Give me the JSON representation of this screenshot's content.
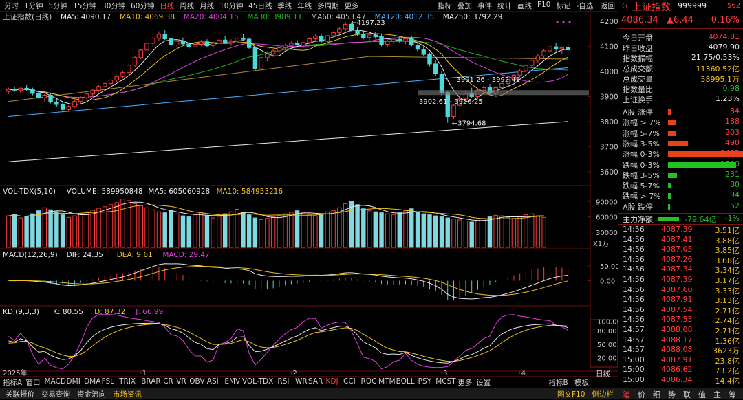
{
  "topbar": {
    "left": [
      "分时",
      "1分钟",
      "5分钟",
      "15分钟",
      "30分钟",
      "60分钟",
      "日线",
      "周线",
      "月线",
      "10分钟",
      "45日线",
      "季线",
      "年线",
      "多周期",
      "更多"
    ],
    "active": "日线",
    "right": [
      "指标",
      "叠加",
      "事件",
      "统计",
      "画线",
      "F10",
      "标记",
      "-自选",
      "返回"
    ]
  },
  "main": {
    "title": "上证指数(日线)",
    "legend": [
      {
        "label": "MA5: 4090.17",
        "color": "#e8e8e8"
      },
      {
        "label": "MA10: 4069.38",
        "color": "#f0c020"
      },
      {
        "label": "MA20: 4004.15",
        "color": "#e040e0"
      },
      {
        "label": "MA30: 3989.11",
        "color": "#20b020"
      },
      {
        "label": "MA60: 4053.47",
        "color": "#c0c0c0"
      },
      {
        "label": "MA120: 4012.35",
        "color": "#4ab0ff"
      },
      {
        "label": "MA250: 3792.29",
        "color": "#e8e8e8"
      }
    ],
    "annotations": [
      "4197.23",
      "3794.68",
      "3991.26 - 3992.41",
      "3902.61 - 3926.25"
    ]
  },
  "vol": {
    "legend": [
      {
        "label": "VOL-TDX(5,10)",
        "color": "#e8e8e8"
      },
      {
        "label": "VOLUME: 589950848",
        "color": "#e8e8e8"
      },
      {
        "label": "MA5: 605060928",
        "color": "#e8e8e8"
      },
      {
        "label": "MA10: 584953216",
        "color": "#f0c020"
      }
    ],
    "unit": "X1万"
  },
  "macd": {
    "legend": [
      {
        "label": "MACD(12,26,9)",
        "color": "#e8e8e8"
      },
      {
        "label": "DIF: 24.35",
        "color": "#e8e8e8"
      },
      {
        "label": "DEA: 9.61",
        "color": "#f0c020"
      },
      {
        "label": "MACD: 29.47",
        "color": "#e040e0"
      }
    ]
  },
  "kdj": {
    "legend": [
      {
        "label": "KDJ(9,3,3)",
        "color": "#e8e8e8"
      },
      {
        "label": "K: 80.55",
        "color": "#e8e8e8"
      },
      {
        "label": "D: 87.32",
        "color": "#f0c020"
      },
      {
        "label": "J: 66.99",
        "color": "#e040e0"
      }
    ]
  },
  "xaxis": {
    "year_label": "2025年",
    "months": [
      "1",
      "2",
      "3",
      "4"
    ],
    "period": "日线"
  },
  "bottombar": {
    "items": [
      "指标A",
      "窗口",
      "MACD",
      "DMI",
      "DMA",
      "FSL",
      "TRIX",
      "BRAR",
      "CR",
      "VR",
      "OBV",
      "ASI",
      "EMV",
      "VOL-TDX",
      "RSI",
      "WR",
      "SAR",
      "KDJ",
      "CCI",
      "ROC",
      "MTM",
      "BOLL",
      "PSY",
      "MCST",
      "更多",
      "设置"
    ],
    "active": "KDJ",
    "right": [
      "指标B",
      "模板"
    ]
  },
  "statusbar": {
    "items": [
      "关联报价",
      "交易查询",
      "资金流向",
      "市场资讯"
    ],
    "active": "市场资讯",
    "right": [
      "图文F10",
      "侧边栏"
    ]
  },
  "panel": {
    "name": "上证指数",
    "code": "999999",
    "flag": "G",
    "badge": "$62",
    "price": "4086.34",
    "change": "▲6.44",
    "pct": "0.16%",
    "stats": [
      {
        "label": "今日开盘",
        "value": "4074.81",
        "cls": "red"
      },
      {
        "label": "昨日收盘",
        "value": "4079.90",
        "cls": "wht"
      },
      {
        "label": "指数振幅",
        "value": "21.75/0.53%",
        "cls": "wht"
      },
      {
        "label": "总成交额",
        "value": "11360.52亿",
        "cls": "yel"
      },
      {
        "label": "总成交量",
        "value": "58995.1万",
        "cls": "yel"
      },
      {
        "label": "指数量比",
        "value": "0.98",
        "cls": "grn"
      },
      {
        "label": "上证换手",
        "value": "1.23%",
        "cls": "wht"
      }
    ],
    "breadth": [
      {
        "label": "A股 涨停",
        "value": "84",
        "dir": "up"
      },
      {
        "label": "涨幅 > 7%",
        "value": "188",
        "dir": "up"
      },
      {
        "label": "涨幅 5-7%",
        "value": "203",
        "dir": "up"
      },
      {
        "label": "涨幅 3-5%",
        "value": "490",
        "dir": "up"
      },
      {
        "label": "涨幅 0-3%",
        "value": "2403",
        "dir": "up"
      },
      {
        "label": "跌幅 0-3%",
        "value": "1700",
        "dir": "down"
      },
      {
        "label": "跌幅 3-5%",
        "value": "231",
        "dir": "down"
      },
      {
        "label": "跌幅 5-7%",
        "value": "80",
        "dir": "down"
      },
      {
        "label": "跌幅 > 7%",
        "value": "94",
        "dir": "down"
      },
      {
        "label": "A股 跌停",
        "value": "52",
        "dir": "down"
      }
    ],
    "capital": {
      "label": "主力净额",
      "value": "-79.64亿",
      "pct": "-1%",
      "ratio": 0.3
    },
    "ticks": [
      [
        "14:56",
        "4087.39",
        "3.51亿"
      ],
      [
        "14:56",
        "4087.41",
        "3.88亿"
      ],
      [
        "14:56",
        "4087.05",
        "3.85亿"
      ],
      [
        "14:56",
        "4087.26",
        "3.68亿"
      ],
      [
        "14:56",
        "4087.34",
        "3.34亿"
      ],
      [
        "14:56",
        "4087.39",
        "3.17亿"
      ],
      [
        "14:56",
        "4087.60",
        "3.33亿"
      ],
      [
        "14:56",
        "4087.91",
        "3.13亿"
      ],
      [
        "14:56",
        "4087.54",
        "2.71亿"
      ],
      [
        "14:56",
        "4087.53",
        "2.74亿"
      ],
      [
        "14:57",
        "4088.08",
        "2.71亿"
      ],
      [
        "14:57",
        "4088.17",
        "1.36亿"
      ],
      [
        "14:57",
        "4088.08",
        "3623万"
      ],
      [
        "15:00",
        "4087.91",
        "23.8亿"
      ],
      [
        "15:00",
        "4086.62",
        "73.2亿"
      ],
      [
        "15:00",
        "4086.34",
        "14.4亿"
      ]
    ],
    "tabs": [
      "笔",
      "价",
      "细",
      "势",
      "联",
      "值",
      "主",
      "筹"
    ]
  },
  "chart_data": [
    {
      "type": "candlestick",
      "title": "上证指数(日线)",
      "ylim": [
        3550,
        4230
      ],
      "yticks": [
        3600,
        3700,
        3800,
        3900,
        4000,
        4100,
        4200
      ],
      "x_months": [
        "1",
        "2",
        "3",
        "4"
      ],
      "candles": [
        [
          3920,
          3935,
          3910,
          3928
        ],
        [
          3928,
          3940,
          3918,
          3925
        ],
        [
          3925,
          3938,
          3915,
          3933
        ],
        [
          3933,
          3945,
          3922,
          3927
        ],
        [
          3927,
          3935,
          3905,
          3912
        ],
        [
          3912,
          3920,
          3890,
          3895
        ],
        [
          3895,
          3910,
          3880,
          3905
        ],
        [
          3905,
          3915,
          3872,
          3878
        ],
        [
          3878,
          3890,
          3860,
          3868
        ],
        [
          3868,
          3880,
          3840,
          3848
        ],
        [
          3848,
          3865,
          3838,
          3860
        ],
        [
          3860,
          3885,
          3855,
          3880
        ],
        [
          3880,
          3900,
          3872,
          3895
        ],
        [
          3895,
          3915,
          3888,
          3910
        ],
        [
          3910,
          3930,
          3900,
          3925
        ],
        [
          3925,
          3945,
          3918,
          3940
        ],
        [
          3940,
          3958,
          3930,
          3952
        ],
        [
          3952,
          3970,
          3945,
          3965
        ],
        [
          3965,
          3985,
          3958,
          3980
        ],
        [
          3980,
          4000,
          3972,
          3995
        ],
        [
          3995,
          4030,
          3990,
          4025
        ],
        [
          4025,
          4060,
          4018,
          4055
        ],
        [
          4055,
          4090,
          4048,
          4085
        ],
        [
          4085,
          4120,
          4078,
          4112
        ],
        [
          4112,
          4140,
          4100,
          4132
        ],
        [
          4132,
          4160,
          4120,
          4148
        ],
        [
          4148,
          4165,
          4125,
          4130
        ],
        [
          4130,
          4140,
          4098,
          4105
        ],
        [
          4105,
          4125,
          4095,
          4120
        ],
        [
          4120,
          4135,
          4105,
          4110
        ],
        [
          4110,
          4120,
          4090,
          4098
        ],
        [
          4098,
          4112,
          4085,
          4108
        ],
        [
          4108,
          4125,
          4100,
          4118
        ],
        [
          4118,
          4128,
          4098,
          4102
        ],
        [
          4102,
          4118,
          4092,
          4112
        ],
        [
          4112,
          4132,
          4105,
          4125
        ],
        [
          4125,
          4140,
          4110,
          4115
        ],
        [
          4115,
          4128,
          4102,
          4120
        ],
        [
          4120,
          4138,
          4112,
          4132
        ],
        [
          4132,
          4148,
          4122,
          4128
        ],
        [
          4128,
          4135,
          4090,
          4095
        ],
        [
          4095,
          4100,
          4000,
          4010
        ],
        [
          4010,
          4060,
          4005,
          4055
        ],
        [
          4055,
          4080,
          4040,
          4070
        ],
        [
          4070,
          4090,
          4058,
          4082
        ],
        [
          4082,
          4100,
          4072,
          4094
        ],
        [
          4094,
          4110,
          4085,
          4104
        ],
        [
          4104,
          4120,
          4095,
          4112
        ],
        [
          4112,
          4125,
          4100,
          4105
        ],
        [
          4105,
          4118,
          4092,
          4115
        ],
        [
          4115,
          4135,
          4108,
          4130
        ],
        [
          4130,
          4148,
          4120,
          4140
        ],
        [
          4140,
          4150,
          4115,
          4120
        ],
        [
          4120,
          4145,
          4115,
          4142
        ],
        [
          4142,
          4160,
          4135,
          4155
        ],
        [
          4155,
          4175,
          4148,
          4170
        ],
        [
          4170,
          4197,
          4160,
          4188
        ],
        [
          4188,
          4192,
          4160,
          4165
        ],
        [
          4165,
          4175,
          4140,
          4148
        ],
        [
          4148,
          4160,
          4128,
          4135
        ],
        [
          4135,
          4150,
          4120,
          4145
        ],
        [
          4145,
          4158,
          4130,
          4138
        ],
        [
          4138,
          4148,
          4100,
          4108
        ],
        [
          4108,
          4125,
          4098,
          4120
        ],
        [
          4120,
          4135,
          4110,
          4128
        ],
        [
          4128,
          4140,
          4115,
          4122
        ],
        [
          4122,
          4135,
          4108,
          4130
        ],
        [
          4130,
          4140,
          4100,
          4105
        ],
        [
          4105,
          4115,
          4080,
          4088
        ],
        [
          4088,
          4100,
          4060,
          4068
        ],
        [
          4068,
          4075,
          4020,
          4030
        ],
        [
          4030,
          4045,
          3980,
          3990
        ],
        [
          3990,
          4000,
          3900,
          3915
        ],
        [
          3915,
          3920,
          3795,
          3820
        ],
        [
          3820,
          3870,
          3810,
          3865
        ],
        [
          3865,
          3900,
          3855,
          3890
        ],
        [
          3890,
          3920,
          3880,
          3912
        ],
        [
          3912,
          3935,
          3895,
          3900
        ],
        [
          3900,
          3930,
          3890,
          3925
        ],
        [
          3925,
          3945,
          3915,
          3935
        ],
        [
          3935,
          3950,
          3905,
          3912
        ],
        [
          3912,
          3940,
          3905,
          3935
        ],
        [
          3935,
          3960,
          3928,
          3952
        ],
        [
          3952,
          3975,
          3945,
          3968
        ],
        [
          3968,
          3990,
          3960,
          3985
        ],
        [
          3985,
          4010,
          3975,
          4002
        ],
        [
          4002,
          4030,
          3995,
          4024
        ],
        [
          4024,
          4050,
          4015,
          4044
        ],
        [
          4044,
          4070,
          4035,
          4062
        ],
        [
          4062,
          4090,
          4052,
          4082
        ],
        [
          4082,
          4105,
          4070,
          4098
        ],
        [
          4098,
          4115,
          4080,
          4090
        ],
        [
          4090,
          4100,
          4070,
          4095
        ],
        [
          4095,
          4110,
          4075,
          4086
        ]
      ],
      "annotations": [
        {
          "label": "4197.23",
          "value": 4197.23
        },
        {
          "label": "3794.68",
          "value": 3794.68
        },
        {
          "label": "3991.26 - 3992.41",
          "value": 3992
        },
        {
          "label": "3902.61 - 3926.25",
          "value": 3914
        }
      ]
    },
    {
      "type": "bar",
      "title": "VOL-TDX(5,10)",
      "unit": "X1万",
      "ylim": [
        0,
        100000
      ],
      "yticks": [
        30000,
        60000,
        90000
      ],
      "values": [
        62000,
        65000,
        58000,
        61000,
        66000,
        72000,
        78000,
        74000,
        70000,
        64000,
        59000,
        62000,
        66000,
        70000,
        73000,
        77000,
        80000,
        84000,
        88000,
        95000,
        92000,
        86000,
        82000,
        78000,
        74000,
        70000,
        68000,
        72000,
        66000,
        62000,
        60000,
        64000,
        68000,
        62000,
        58000,
        61000,
        66000,
        70000,
        75000,
        69000,
        64000,
        58000,
        55000,
        57000,
        60000,
        63000,
        66000,
        69000,
        72000,
        68000,
        64000,
        62000,
        66000,
        70000,
        72000,
        78000,
        86000,
        90000,
        84000,
        76000,
        72000,
        70000,
        68000,
        66000,
        64000,
        68000,
        72000,
        76000,
        70000,
        66000,
        64000,
        62000,
        60000,
        58000,
        56000,
        54000,
        52000,
        50000,
        53000,
        57000,
        60000,
        63000,
        62000,
        59000,
        57000,
        60000,
        64000,
        66000,
        62000,
        59000
      ]
    },
    {
      "type": "bar+line",
      "title": "MACD(12,26,9)",
      "ylim": [
        -75,
        75
      ],
      "yticks": [
        0,
        50
      ],
      "series": [
        {
          "name": "DIF"
        },
        {
          "name": "DEA"
        },
        {
          "name": "MACD"
        }
      ]
    },
    {
      "type": "line",
      "title": "KDJ(9,3,3)",
      "ylim": [
        0,
        110
      ],
      "yticks": [
        20,
        50,
        80,
        100
      ],
      "series": [
        {
          "name": "K"
        },
        {
          "name": "D"
        },
        {
          "name": "J"
        }
      ]
    }
  ]
}
